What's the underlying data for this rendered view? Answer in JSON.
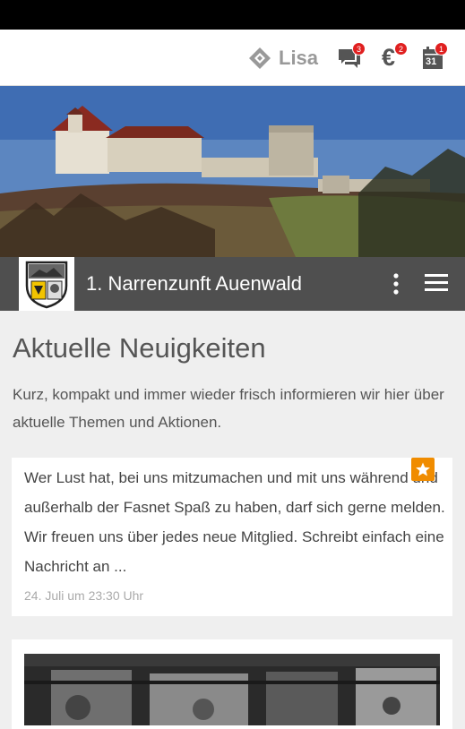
{
  "topbar": {
    "user_name": "Lisa",
    "messages_badge": "3",
    "payments_badge": "2",
    "calendar_badge": "1",
    "calendar_day": "31",
    "accent": "#e02020"
  },
  "header": {
    "club_name": "1. Narrenzunft Auenwald"
  },
  "main": {
    "heading": "Aktuelle Neuigkeiten",
    "intro": "Kurz, kompakt und immer wieder frisch informieren wir hier über aktuelle Themen und Aktionen."
  },
  "posts": [
    {
      "text": "Wer Lust hat, bei uns mitzumachen und mit uns während und außerhalb der Fasnet Spaß zu haben, darf sich gerne melden. Wir freuen uns über jedes neue Mitglied. Schreibt einfach eine Nachricht an ...",
      "date": "24. Juli um 23:30 Uhr",
      "starred_color": "#f08c00"
    }
  ]
}
